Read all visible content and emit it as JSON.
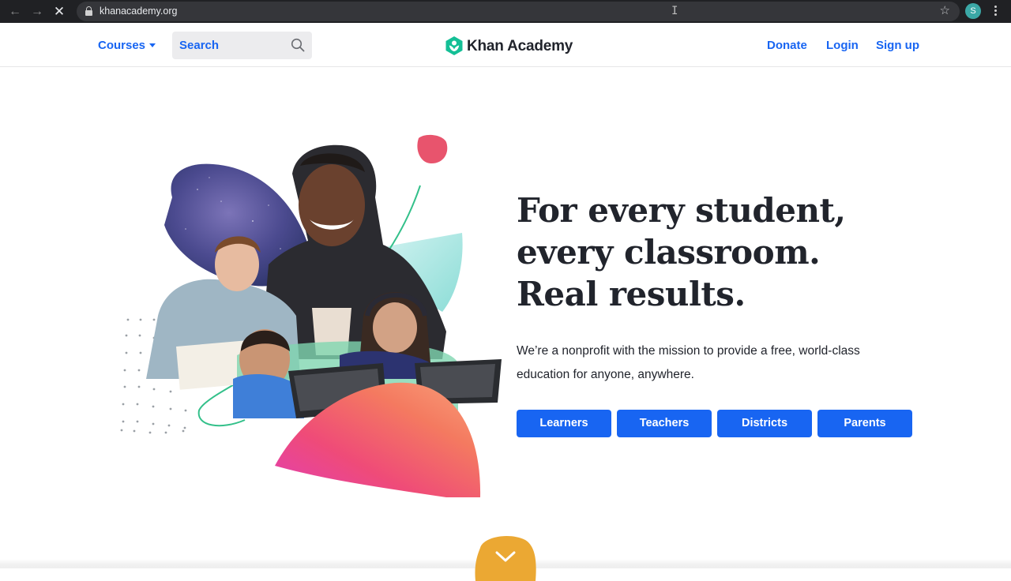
{
  "browser": {
    "url": "khanacademy.org",
    "profile_initial": "S",
    "icons": {
      "back": "arrow-left-icon",
      "forward": "arrow-right-icon",
      "stop": "close-icon",
      "lock": "lock-icon",
      "bookmark": "star-icon",
      "menu": "more-vertical-icon",
      "cursor": "text-cursor-icon"
    },
    "glyphs": {
      "back": "←",
      "forward": "→",
      "stop": "✕",
      "star": "☆",
      "cursor": "I"
    }
  },
  "header": {
    "courses_label": "Courses",
    "search_placeholder": "Search",
    "logo_text": "Khan Academy",
    "donate_label": "Donate",
    "login_label": "Login",
    "signup_label": "Sign up"
  },
  "hero": {
    "headline": [
      "For every student,",
      "every classroom.",
      "Real results."
    ],
    "tagline": "We’re a nonprofit with the mission to provide a free, world-class education for anyone, anywhere.",
    "buttons": [
      "Learners",
      "Teachers",
      "Districts",
      "Parents"
    ],
    "art_description": "Collage of students with tablets over galaxy, teal and pink shapes"
  },
  "colors": {
    "brand_blue": "#1865f2",
    "logo_green": "#14bf96",
    "heading": "#21242c",
    "scroll_blob": "#eba833"
  }
}
